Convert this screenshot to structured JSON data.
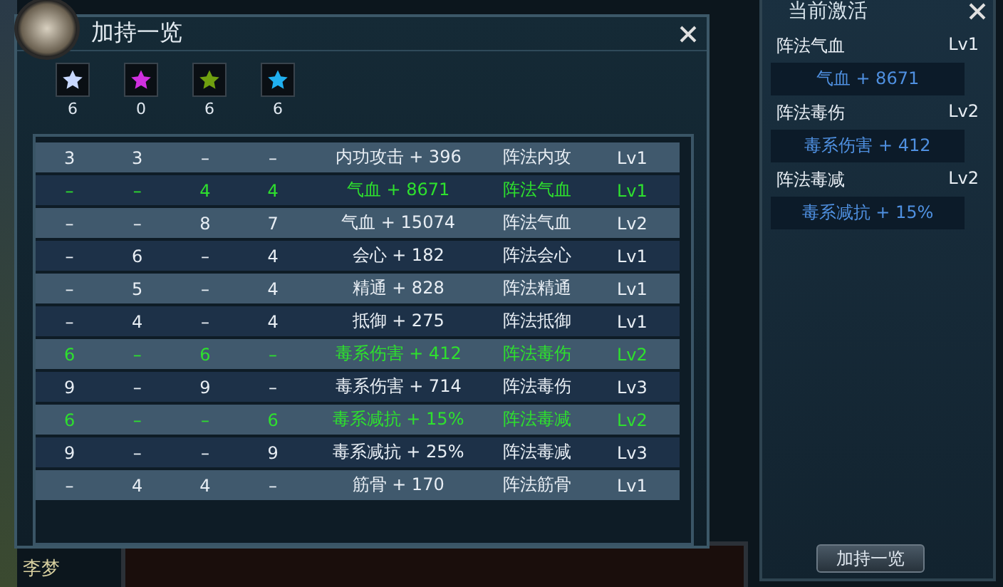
{
  "dialog": {
    "title": "加持一览"
  },
  "star_counts": [
    {
      "color": "#c8d8ff",
      "count": "6"
    },
    {
      "color": "#d030e0",
      "count": "0"
    },
    {
      "color": "#70a010",
      "count": "6"
    },
    {
      "color": "#20b0f0",
      "count": "6"
    }
  ],
  "table": {
    "rows": [
      {
        "active": false,
        "cells": [
          "3",
          "3",
          "–",
          "–",
          "内功攻击 + 396",
          "阵法内攻",
          "Lv1"
        ]
      },
      {
        "active": true,
        "cells": [
          "–",
          "–",
          "4",
          "4",
          "气血 + 8671",
          "阵法气血",
          "Lv1"
        ]
      },
      {
        "active": false,
        "cells": [
          "–",
          "–",
          "8",
          "7",
          "气血 + 15074",
          "阵法气血",
          "Lv2"
        ]
      },
      {
        "active": false,
        "cells": [
          "–",
          "6",
          "–",
          "4",
          "会心 + 182",
          "阵法会心",
          "Lv1"
        ]
      },
      {
        "active": false,
        "cells": [
          "–",
          "5",
          "–",
          "4",
          "精通 + 828",
          "阵法精通",
          "Lv1"
        ]
      },
      {
        "active": false,
        "cells": [
          "–",
          "4",
          "–",
          "4",
          "抵御 + 275",
          "阵法抵御",
          "Lv1"
        ]
      },
      {
        "active": true,
        "cells": [
          "6",
          "–",
          "6",
          "–",
          "毒系伤害 + 412",
          "阵法毒伤",
          "Lv2"
        ]
      },
      {
        "active": false,
        "cells": [
          "9",
          "–",
          "9",
          "–",
          "毒系伤害 + 714",
          "阵法毒伤",
          "Lv3"
        ]
      },
      {
        "active": true,
        "cells": [
          "6",
          "–",
          "–",
          "6",
          "毒系减抗 + 15%",
          "阵法毒减",
          "Lv2"
        ]
      },
      {
        "active": false,
        "cells": [
          "9",
          "–",
          "–",
          "9",
          "毒系减抗 + 25%",
          "阵法毒减",
          "Lv3"
        ]
      },
      {
        "active": false,
        "cells": [
          "–",
          "4",
          "4",
          "–",
          "筋骨 + 170",
          "阵法筋骨",
          "Lv1"
        ]
      }
    ]
  },
  "side_panel": {
    "title": "当前激活",
    "entries": [
      {
        "name": "阵法气血",
        "level": "Lv1",
        "effect": "气血 + 8671"
      },
      {
        "name": "阵法毒伤",
        "level": "Lv2",
        "effect": "毒系伤害 + 412"
      },
      {
        "name": "阵法毒减",
        "level": "Lv2",
        "effect": "毒系减抗 + 15%"
      }
    ],
    "button": "加持一览"
  },
  "background": {
    "name": "李梦"
  }
}
